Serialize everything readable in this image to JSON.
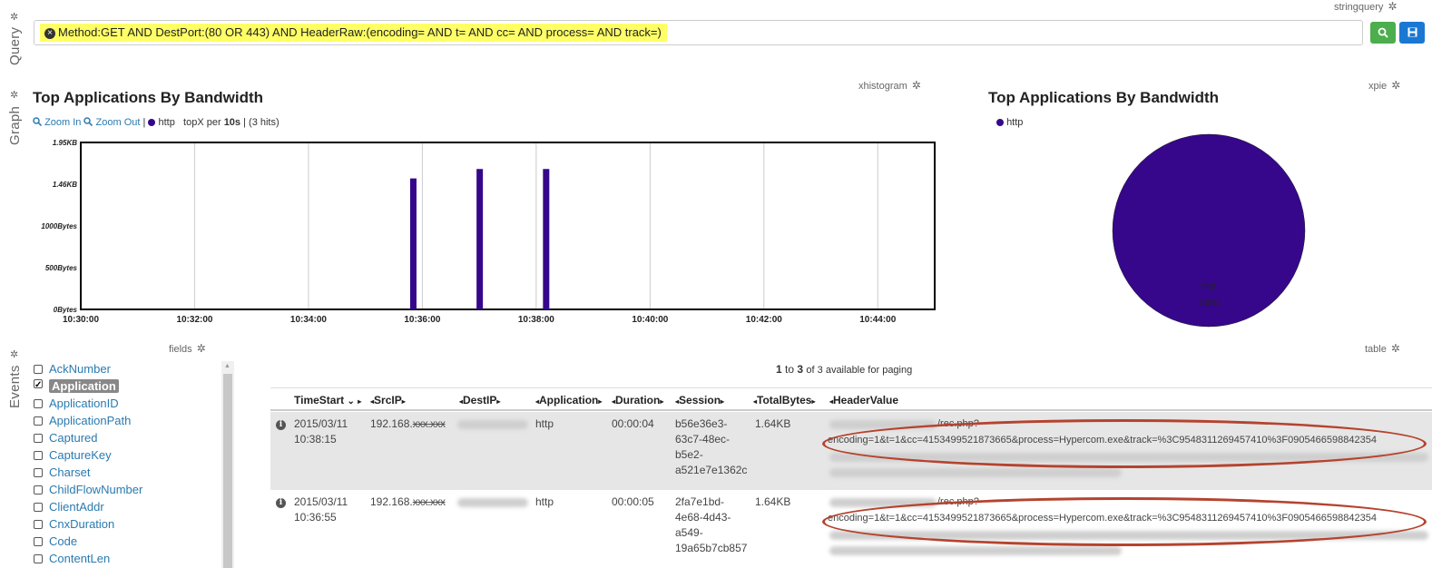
{
  "query": {
    "panel_tag": "stringquery",
    "side_label": "Query",
    "text": "Method:GET AND DestPort:(80 OR 443) AND HeaderRaw:(encoding= AND t= AND cc= AND process= AND track=)"
  },
  "graph": {
    "side_label": "Graph",
    "histogram_tag": "xhistogram",
    "pie_tag": "xpie",
    "histogram_title": "Top Applications By Bandwidth",
    "pie_title": "Top Applications By Bandwidth",
    "zoom_in": "Zoom In",
    "zoom_out": "Zoom Out",
    "sep": "|",
    "series_label": "http",
    "topx_prefix": "topX per",
    "topx_interval": "10s",
    "topx_sep": " | ",
    "hits": "(3 hits)",
    "pie_legend": "http",
    "pie_slice_label": "http",
    "pie_slice_pct": "100%"
  },
  "chart_data": [
    {
      "type": "bar",
      "title": "Top Applications By Bandwidth",
      "series": [
        {
          "name": "http",
          "color": "#36078a",
          "points": [
            {
              "time": "10:35:50",
              "bytes_kb": 1.53
            },
            {
              "time": "10:37:00",
              "bytes_kb": 1.64
            },
            {
              "time": "10:38:10",
              "bytes_kb": 1.64
            }
          ]
        }
      ],
      "x_ticks": [
        "10:30:00",
        "10:32:00",
        "10:34:00",
        "10:36:00",
        "10:38:00",
        "10:40:00",
        "10:42:00",
        "10:44:00"
      ],
      "y_ticks": [
        "0Bytes",
        "500Bytes",
        "1000Bytes",
        "1.46KB",
        "1.95KB"
      ],
      "xlim": [
        "10:30:00",
        "10:45:00"
      ],
      "ylim_kb": [
        0,
        1.95
      ],
      "grid": true
    },
    {
      "type": "pie",
      "title": "Top Applications By Bandwidth",
      "slices": [
        {
          "label": "http",
          "value": 100,
          "color": "#36078a"
        }
      ]
    }
  ],
  "events": {
    "side_label": "Events",
    "fields_tag": "fields",
    "table_tag": "table",
    "paging": {
      "from": "1",
      "to_word": "to",
      "to": "3",
      "suffix": "of 3 available for paging"
    },
    "fields": [
      {
        "label": "AckNumber",
        "checked": false
      },
      {
        "label": "Application",
        "checked": true
      },
      {
        "label": "ApplicationID",
        "checked": false
      },
      {
        "label": "ApplicationPath",
        "checked": false
      },
      {
        "label": "Captured",
        "checked": false
      },
      {
        "label": "CaptureKey",
        "checked": false
      },
      {
        "label": "Charset",
        "checked": false
      },
      {
        "label": "ChildFlowNumber",
        "checked": false
      },
      {
        "label": "ClientAddr",
        "checked": false
      },
      {
        "label": "CnxDuration",
        "checked": false
      },
      {
        "label": "Code",
        "checked": false
      },
      {
        "label": "ContentLen",
        "checked": false
      }
    ],
    "columns": [
      "TimeStart",
      "SrcIP",
      "DestIP",
      "Application",
      "Duration",
      "Session",
      "TotalBytes",
      "HeaderValue"
    ],
    "rows": [
      {
        "date": "2015/03/11",
        "time": "10:38:15",
        "src": "192.168.",
        "src_masked": "xxx.xxx",
        "app": "http",
        "duration": "00:00:04",
        "session": [
          "b56e36e3-",
          "63c7-48ec-",
          "b5e2-",
          "a521e7e1362c"
        ],
        "bytes": "1.64KB",
        "header_path": "/rec.php?",
        "header_line": "encoding=1&t=1&cc=4153499521873665&process=Hypercom.exe&track=%3C9548311269457410%3F0905466598842354"
      },
      {
        "date": "2015/03/11",
        "time": "10:36:55",
        "src": "192.168.",
        "src_masked": "xxx.xxx",
        "app": "http",
        "duration": "00:00:05",
        "session": [
          "2fa7e1bd-",
          "4e68-4d43-",
          "a549-",
          "19a65b7cb857"
        ],
        "bytes": "1.64KB",
        "header_path": "/rec.php?",
        "header_line": "encoding=1&t=1&cc=4153499521873665&process=Hypercom.exe&track=%3C9548311269457410%3F0905466598842354"
      }
    ]
  }
}
